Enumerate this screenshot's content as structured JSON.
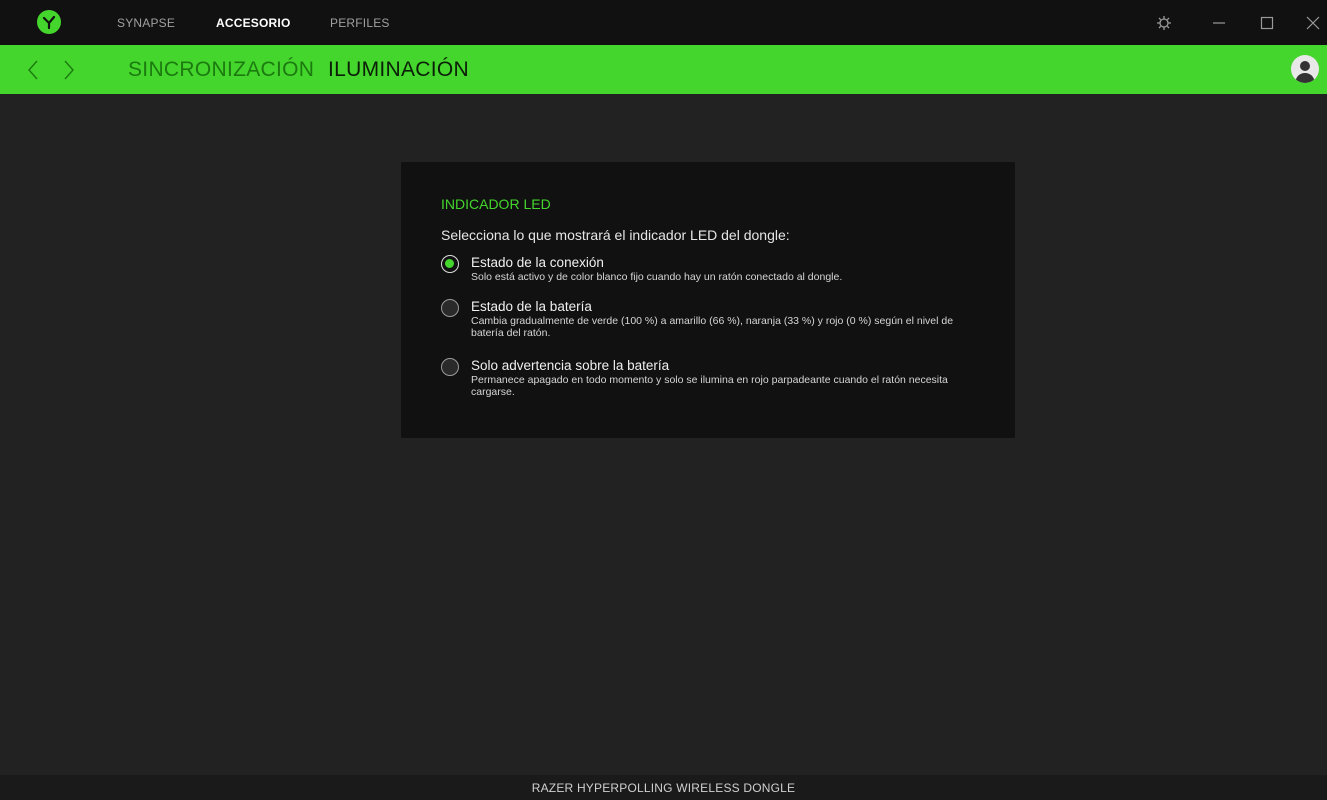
{
  "app": {
    "top_tabs": [
      {
        "label": "SYNAPSE",
        "active": false
      },
      {
        "label": "ACCESORIO",
        "active": true
      },
      {
        "label": "PERFILES",
        "active": false
      }
    ],
    "window_controls": [
      "settings-icon",
      "minimize-icon",
      "maximize-icon",
      "close-icon"
    ]
  },
  "subnav": {
    "tabs": [
      {
        "label": "SINCRONIZACIÓN",
        "active": false
      },
      {
        "label": "ILUMINACIÓN",
        "active": true
      }
    ]
  },
  "card": {
    "title": "INDICADOR LED",
    "prompt": "Selecciona lo que mostrará el indicador LED del dongle:",
    "options": [
      {
        "label": "Estado de la conexión",
        "description": "Solo está activo y de color blanco fijo cuando hay un ratón conectado al dongle.",
        "selected": true
      },
      {
        "label": "Estado de la batería",
        "description": "Cambia gradualmente de verde (100 %) a amarillo (66 %), naranja (33 %) y rojo (0 %) según el nivel de batería del ratón.",
        "selected": false
      },
      {
        "label": "Solo advertencia sobre la batería",
        "description": "Permanece apagado en todo momento y solo se ilumina en rojo parpadeante cuando el ratón necesita cargarse.",
        "selected": false
      }
    ]
  },
  "footer": {
    "device_name": "RAZER HYPERPOLLING WIRELESS DONGLE"
  },
  "colors": {
    "accent": "#44d62c",
    "background": "#222222",
    "card": "#111111"
  }
}
